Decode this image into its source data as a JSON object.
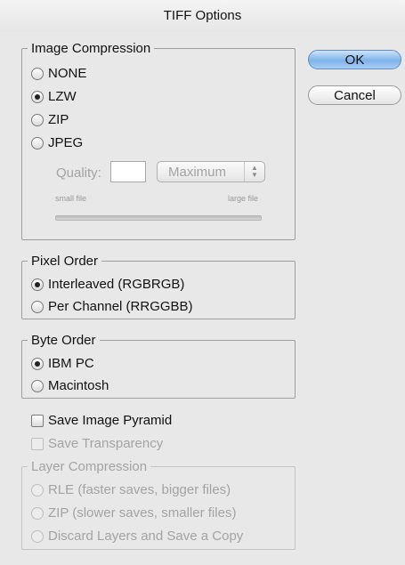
{
  "dialog": {
    "title": "TIFF Options"
  },
  "image_compression": {
    "legend": "Image Compression",
    "options": [
      "NONE",
      "LZW",
      "ZIP",
      "JPEG"
    ],
    "selected": "LZW",
    "quality_label": "Quality:",
    "quality_value": "",
    "quality_preset": "Maximum",
    "small_file_label": "small file",
    "large_file_label": "large file"
  },
  "pixel_order": {
    "legend": "Pixel Order",
    "options": [
      "Interleaved (RGBRGB)",
      "Per Channel (RRGGBB)"
    ],
    "selected": "Interleaved (RGBRGB)"
  },
  "byte_order": {
    "legend": "Byte Order",
    "options": [
      "IBM PC",
      "Macintosh"
    ],
    "selected": "IBM PC"
  },
  "checkboxes": {
    "save_image_pyramid": "Save Image Pyramid",
    "save_transparency": "Save Transparency"
  },
  "layer_compression": {
    "legend": "Layer Compression",
    "options": [
      "RLE (faster saves, bigger files)",
      "ZIP (slower saves, smaller files)",
      "Discard Layers and Save a Copy"
    ]
  },
  "buttons": {
    "ok": "OK",
    "cancel": "Cancel"
  },
  "colors": {
    "default_button": "#7eb3ea",
    "disabled_text": "#a3a3a3",
    "background": "#e8e8e8"
  }
}
